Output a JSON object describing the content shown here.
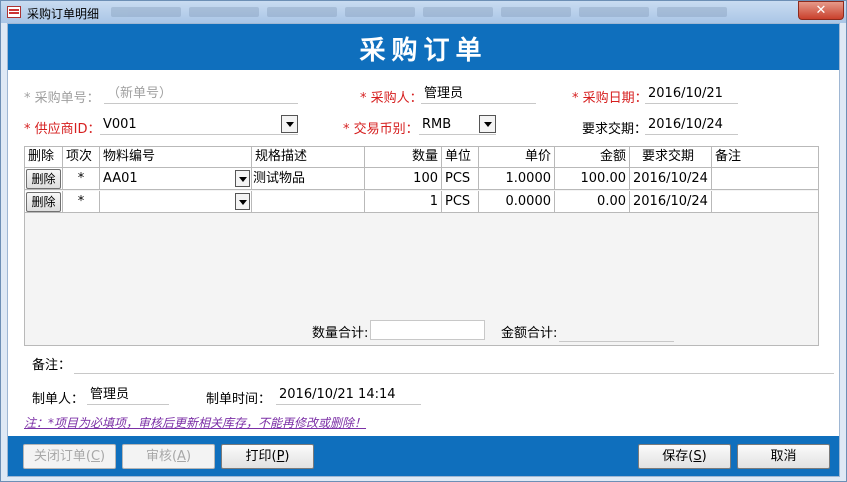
{
  "window": {
    "title": "采购订单明细",
    "close_glyph": "✕"
  },
  "banner": {
    "heading": "采购订单"
  },
  "header": {
    "order_no_label": "* 采购单号：",
    "order_no_value": "（新单号）",
    "buyer_label": "* 采购人：",
    "buyer_value": "管理员",
    "purchase_date_label": "* 采购日期：",
    "purchase_date_value": "2016/10/21",
    "supplier_label": "* 供应商ID：",
    "supplier_value": "V001",
    "currency_label": "* 交易币别：",
    "currency_value": "RMB",
    "required_date_label": "要求交期：",
    "required_date_value": "2016/10/24"
  },
  "grid": {
    "columns": [
      "删除",
      "项次",
      "物料编号",
      "规格描述",
      "数量",
      "单位",
      "单价",
      "金额",
      "要求交期",
      "备注"
    ],
    "rows": [
      {
        "delete_label": "删除",
        "item": "*",
        "material": "AA01",
        "spec": "测试物品",
        "qty": "100",
        "unit": "PCS",
        "price": "1.0000",
        "amount": "100.00",
        "due": "2016/10/24",
        "remark": ""
      },
      {
        "delete_label": "删除",
        "item": "*",
        "material": "",
        "spec": "",
        "qty": "1",
        "unit": "PCS",
        "price": "0.0000",
        "amount": "0.00",
        "due": "2016/10/24",
        "remark": ""
      }
    ],
    "qty_total_label": "数量合计:",
    "amount_total_label": "金额合计:"
  },
  "remarks_label": "备注：",
  "creator_label": "制单人：",
  "creator_value": "管理员",
  "created_time_label": "制单时间：",
  "created_time_value": "2016/10/21 14:14",
  "note": "注：*项目为必填项，审核后更新相关库存，不能再修改或删除！",
  "buttons": {
    "close_order": {
      "label": "关闭订单(",
      "key": "C",
      "tail": ")"
    },
    "audit": {
      "label": "审核(",
      "key": "A",
      "tail": ")"
    },
    "print": {
      "label": "打印(",
      "key": "P",
      "tail": ")"
    },
    "save": {
      "label": "保存(",
      "key": "S",
      "tail": ")"
    },
    "cancel": {
      "label": "取消"
    }
  },
  "colors": {
    "banner": "#0f6fbd",
    "required": "#d61f1f",
    "note": "#7b2fa6"
  }
}
